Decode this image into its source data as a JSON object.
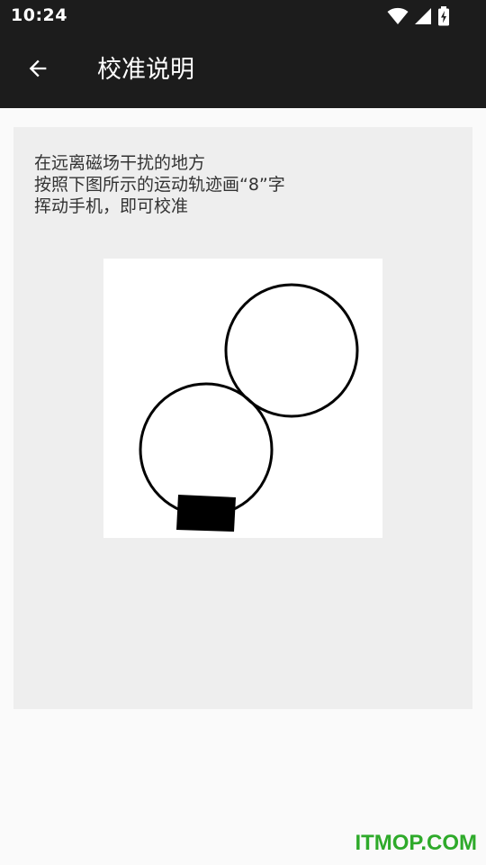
{
  "status_bar": {
    "time": "10:24",
    "icons": [
      "wifi-icon",
      "cell-signal-icon",
      "battery-charging-icon"
    ]
  },
  "app_bar": {
    "title": "校准说明",
    "back_icon": "arrow-left-icon"
  },
  "card": {
    "instructions": [
      "在远离磁场干扰的地方",
      "按照下图所示的运动轨迹画“8”字",
      "挥动手机，即可校准"
    ],
    "illustration": {
      "depicts": "figure-8 motion path with phone",
      "icons": [
        "phone-icon"
      ]
    }
  },
  "watermark": {
    "text": "ITMOP.COM",
    "color": "#2eaa2a"
  },
  "colors": {
    "app_bar": "#1c1c1c",
    "background": "#fafafa",
    "card": "#eeeeee",
    "text": "#333333"
  }
}
